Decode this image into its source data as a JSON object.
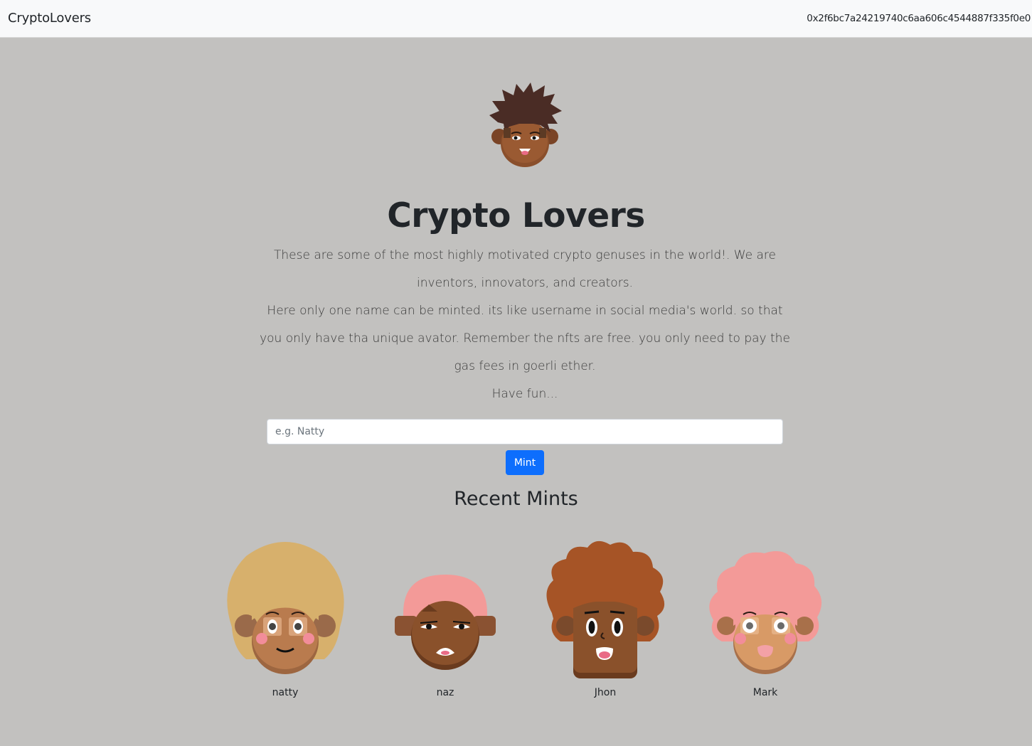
{
  "navbar": {
    "brand": "CryptoLovers",
    "wallet_address": "0x2f6bc7a24219740c6aa606c4544887f335f0e0"
  },
  "hero": {
    "avatar_icon": "avatar-icon",
    "title": "Crypto Lovers",
    "description_1": "These are some of the most highly motivated crypto genuses in the world!. We are inventors, innovators, and creators.",
    "description_2": "Here only one name can be minted. its like username in social media's world. so that you only have tha unique avator. Remember the nfts are free. you only need to pay the gas fees in goerli ether.",
    "description_3": "Have fun..."
  },
  "mint_form": {
    "input_value": "",
    "input_placeholder": "e.g. Natty",
    "button_label": "Mint",
    "button_color": "#0d6efd"
  },
  "recent": {
    "title": "Recent Mints",
    "items": [
      {
        "name": "natty",
        "icon": "avatar-icon"
      },
      {
        "name": "naz",
        "icon": "avatar-icon"
      },
      {
        "name": "Jhon",
        "icon": "avatar-icon"
      },
      {
        "name": "Mark",
        "icon": "avatar-icon"
      }
    ]
  },
  "colors": {
    "page_background": "#c2c1bf",
    "navbar_background": "#f8f9fa"
  }
}
